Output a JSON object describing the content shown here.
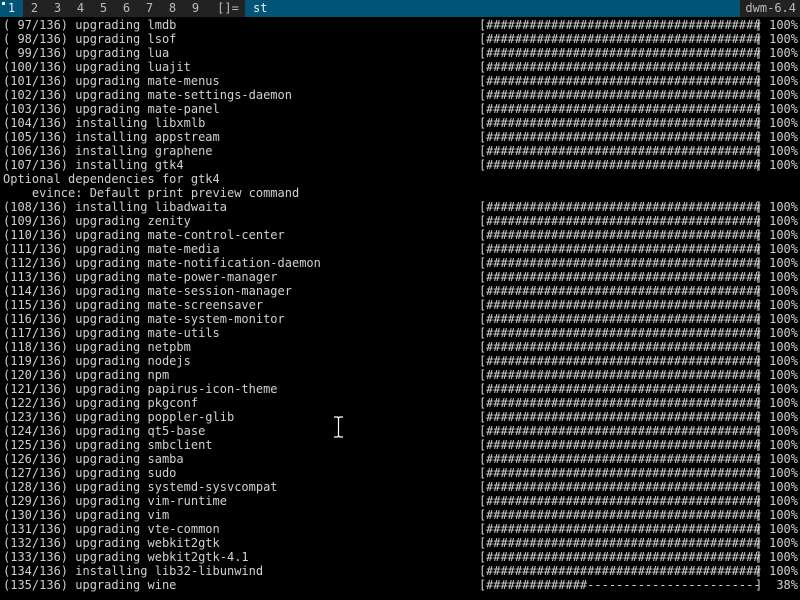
{
  "topbar": {
    "tags": [
      "1",
      "2",
      "3",
      "4",
      "5",
      "6",
      "7",
      "8",
      "9"
    ],
    "selected_tag": "1",
    "layout_symbol": "[]=",
    "window_title": "st",
    "status_text": "dwm-6.4"
  },
  "terminal": {
    "lines": [
      {
        "text": "( 97/136) upgrading lmdb",
        "bar": "######################################",
        "pct": "100%"
      },
      {
        "text": "( 98/136) upgrading lsof",
        "bar": "######################################",
        "pct": "100%"
      },
      {
        "text": "( 99/136) upgrading lua",
        "bar": "######################################",
        "pct": "100%"
      },
      {
        "text": "(100/136) upgrading luajit",
        "bar": "######################################",
        "pct": "100%"
      },
      {
        "text": "(101/136) upgrading mate-menus",
        "bar": "######################################",
        "pct": "100%"
      },
      {
        "text": "(102/136) upgrading mate-settings-daemon",
        "bar": "######################################",
        "pct": "100%"
      },
      {
        "text": "(103/136) upgrading mate-panel",
        "bar": "######################################",
        "pct": "100%"
      },
      {
        "text": "(104/136) installing libxmlb",
        "bar": "######################################",
        "pct": "100%"
      },
      {
        "text": "(105/136) installing appstream",
        "bar": "######################################",
        "pct": "100%"
      },
      {
        "text": "(106/136) installing graphene",
        "bar": "######################################",
        "pct": "100%"
      },
      {
        "text": "(107/136) installing gtk4",
        "bar": "######################################",
        "pct": "100%"
      },
      {
        "text": "Optional dependencies for gtk4",
        "bar": "",
        "pct": ""
      },
      {
        "text": "    evince: Default print preview command",
        "bar": "",
        "pct": ""
      },
      {
        "text": "(108/136) installing libadwaita",
        "bar": "######################################",
        "pct": "100%"
      },
      {
        "text": "(109/136) upgrading zenity",
        "bar": "######################################",
        "pct": "100%"
      },
      {
        "text": "(110/136) upgrading mate-control-center",
        "bar": "######################################",
        "pct": "100%"
      },
      {
        "text": "(111/136) upgrading mate-media",
        "bar": "######################################",
        "pct": "100%"
      },
      {
        "text": "(112/136) upgrading mate-notification-daemon",
        "bar": "######################################",
        "pct": "100%"
      },
      {
        "text": "(113/136) upgrading mate-power-manager",
        "bar": "######################################",
        "pct": "100%"
      },
      {
        "text": "(114/136) upgrading mate-session-manager",
        "bar": "######################################",
        "pct": "100%"
      },
      {
        "text": "(115/136) upgrading mate-screensaver",
        "bar": "######################################",
        "pct": "100%"
      },
      {
        "text": "(116/136) upgrading mate-system-monitor",
        "bar": "######################################",
        "pct": "100%"
      },
      {
        "text": "(117/136) upgrading mate-utils",
        "bar": "######################################",
        "pct": "100%"
      },
      {
        "text": "(118/136) upgrading netpbm",
        "bar": "######################################",
        "pct": "100%"
      },
      {
        "text": "(119/136) upgrading nodejs",
        "bar": "######################################",
        "pct": "100%"
      },
      {
        "text": "(120/136) upgrading npm",
        "bar": "######################################",
        "pct": "100%"
      },
      {
        "text": "(121/136) upgrading papirus-icon-theme",
        "bar": "######################################",
        "pct": "100%"
      },
      {
        "text": "(122/136) upgrading pkgconf",
        "bar": "######################################",
        "pct": "100%"
      },
      {
        "text": "(123/136) upgrading poppler-glib",
        "bar": "######################################",
        "pct": "100%"
      },
      {
        "text": "(124/136) upgrading qt5-base",
        "bar": "######################################",
        "pct": "100%"
      },
      {
        "text": "(125/136) upgrading smbclient",
        "bar": "######################################",
        "pct": "100%"
      },
      {
        "text": "(126/136) upgrading samba",
        "bar": "######################################",
        "pct": "100%"
      },
      {
        "text": "(127/136) upgrading sudo",
        "bar": "######################################",
        "pct": "100%"
      },
      {
        "text": "(128/136) upgrading systemd-sysvcompat",
        "bar": "######################################",
        "pct": "100%"
      },
      {
        "text": "(129/136) upgrading vim-runtime",
        "bar": "######################################",
        "pct": "100%"
      },
      {
        "text": "(130/136) upgrading vim",
        "bar": "######################################",
        "pct": "100%"
      },
      {
        "text": "(131/136) upgrading vte-common",
        "bar": "######################################",
        "pct": "100%"
      },
      {
        "text": "(132/136) upgrading webkit2gtk",
        "bar": "######################################",
        "pct": "100%"
      },
      {
        "text": "(133/136) upgrading webkit2gtk-4.1",
        "bar": "######################################",
        "pct": "100%"
      },
      {
        "text": "(134/136) installing lib32-libunwind",
        "bar": "######################################",
        "pct": "100%"
      },
      {
        "text": "(135/136) upgrading wine",
        "bar": "##############------------------------",
        "pct": " 38%"
      }
    ]
  },
  "colors": {
    "bar_bg": "#222222",
    "bar_selected": "#005577",
    "bar_fg": "#bbbbbb",
    "bar_selected_fg": "#eeeeee",
    "terminal_bg": "#000000",
    "terminal_fg": "#d0d0d0"
  },
  "icons": {
    "mouse_cursor": "text-ibeam-icon"
  }
}
